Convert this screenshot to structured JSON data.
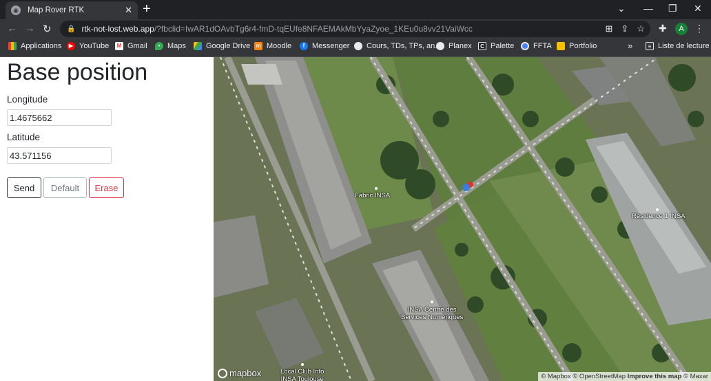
{
  "browser": {
    "tab_title": "Map Rover RTK",
    "url_host": "rtk-not-lost.web.app",
    "url_path": "/?fbclid=IwAR1dOAvbTg6r4-fmD-tqEUfe8NFAEMAkMbYyaZyoe_1KEu0u8vv21VaiWcc",
    "profile_initial": "A"
  },
  "bookmarks": {
    "applications": "Applications",
    "youtube": "YouTube",
    "gmail": "Gmail",
    "maps": "Maps",
    "drive": "Google Drive",
    "moodle": "Moodle",
    "messenger": "Messenger",
    "cours": "Cours, TDs, TPs, an...",
    "planex": "Planex",
    "palette": "Palette",
    "ffta": "FFTA",
    "portfolio": "Portfolio",
    "more": "»",
    "reading_list": "Liste de lecture"
  },
  "form": {
    "title": "Base position",
    "longitude_label": "Longitude",
    "longitude_value": "1.4675662",
    "latitude_label": "Latitude",
    "latitude_value": "43.571156",
    "send": "Send",
    "default": "Default",
    "erase": "Erase"
  },
  "map": {
    "labels": {
      "fabric": "Fabric INSA",
      "residence": "Résidence 1 INSA",
      "centre_line1": "INSA Centre des",
      "centre_line2": "Services Numériques",
      "club_line1": "Local Club Info",
      "club_line2": "INSA Toulouse"
    },
    "logo": "mapbox",
    "attribution_1": "© Mapbox © OpenStreetMap",
    "attribution_improve": "Improve this map",
    "attribution_2": "© Maxar",
    "colors": {
      "rover": "#3b7dd8",
      "base": "#e0322b"
    }
  }
}
